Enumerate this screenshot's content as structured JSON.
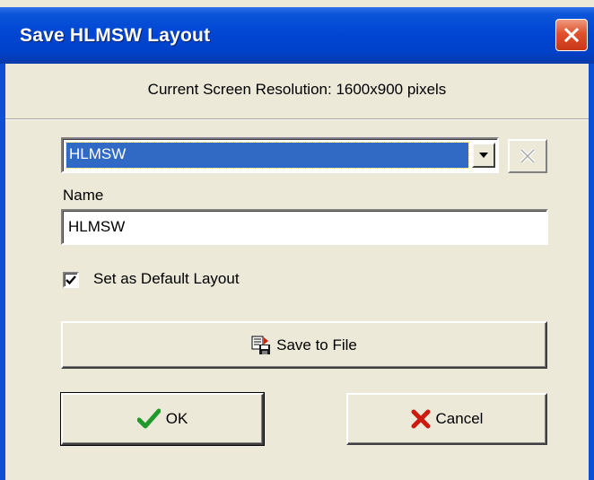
{
  "window": {
    "title": "Save HLMSW Layout"
  },
  "info": {
    "resolution_text": "Current Screen Resolution: 1600x900 pixels"
  },
  "layout_select": {
    "selected_value": "HLMSW"
  },
  "name_field": {
    "label": "Name",
    "value": "HLMSW"
  },
  "default_checkbox": {
    "label": "Set as Default Layout",
    "checked": true
  },
  "buttons": {
    "save_to_file": "Save to File",
    "ok": "OK",
    "cancel": "Cancel"
  },
  "icons": {
    "close": "close-icon",
    "dropdown": "chevron-down-icon",
    "delete": "delete-icon",
    "checkmark": "checkmark-icon",
    "save_file": "save-file-icon",
    "ok": "green-check-icon",
    "cancel": "red-x-icon"
  },
  "colors": {
    "titlebar": "#0046d4",
    "selection": "#316ac5",
    "dialog_bg": "#ece9d8",
    "close_button": "#e0522c",
    "ok_check": "#1f9a2a",
    "cancel_x": "#cc1a10"
  }
}
